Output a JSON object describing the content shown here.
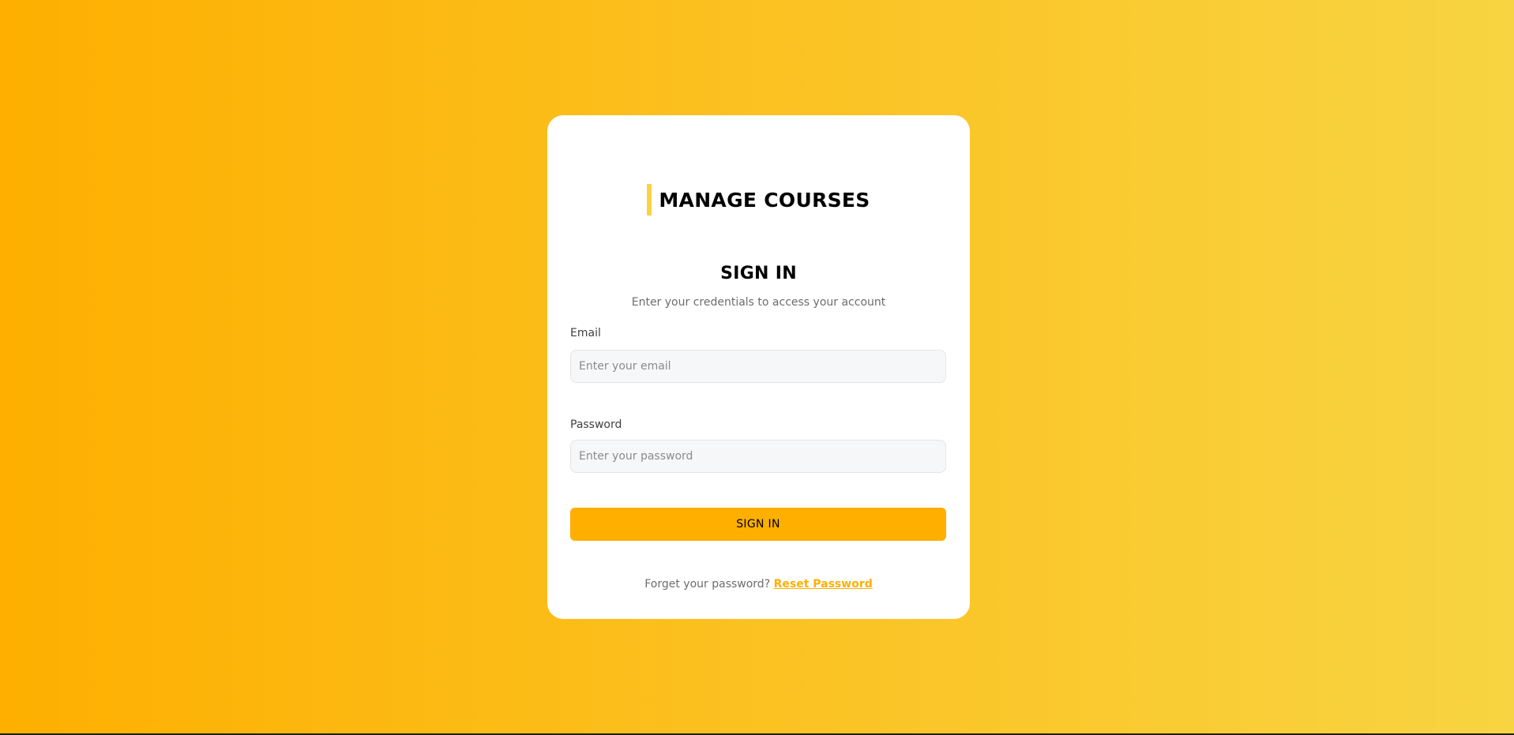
{
  "brand": {
    "title": "MANAGE COURSES",
    "accent_color": "#F8D442"
  },
  "signin": {
    "heading": "SIGN IN",
    "subheading": "Enter your credentials to access your account"
  },
  "form": {
    "email": {
      "label": "Email",
      "placeholder": "Enter your email",
      "value": ""
    },
    "password": {
      "label": "Password",
      "placeholder": "Enter your password",
      "value": ""
    },
    "submit_label": "SIGN IN"
  },
  "footer": {
    "prompt": "Forget your password?",
    "link_label": "Reset Password"
  },
  "colors": {
    "background_start": "#FEAF00",
    "background_end": "#F8D442",
    "primary": "#FEAF00",
    "card": "#FFFFFF"
  }
}
